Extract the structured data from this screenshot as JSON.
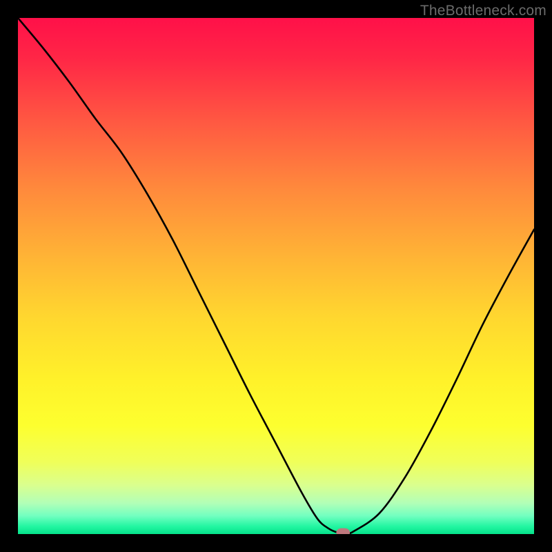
{
  "watermark": "TheBottleneck.com",
  "chart_data": {
    "type": "line",
    "title": "",
    "xlabel": "",
    "ylabel": "",
    "xlim": [
      0,
      100
    ],
    "ylim": [
      0,
      100
    ],
    "legend": "none",
    "grid": false,
    "x": [
      0,
      5,
      10,
      15,
      20,
      25,
      30,
      35,
      40,
      45,
      50,
      55,
      58,
      60,
      62,
      64,
      65,
      70,
      75,
      80,
      85,
      90,
      95,
      100
    ],
    "y": [
      100,
      94,
      87.5,
      80.5,
      74,
      66,
      57,
      47,
      37,
      27,
      17.5,
      8,
      3,
      1.2,
      0.3,
      0.3,
      0.5,
      4,
      11,
      20,
      30,
      40.5,
      50,
      59
    ],
    "marker": {
      "x": 63,
      "y": 0.3,
      "color": "#be787d",
      "radius": 1.2
    },
    "background": {
      "type": "vertical-gradient",
      "stops": [
        {
          "offset": 0.0,
          "color": "#ff1049"
        },
        {
          "offset": 0.08,
          "color": "#ff2746"
        },
        {
          "offset": 0.2,
          "color": "#ff5842"
        },
        {
          "offset": 0.33,
          "color": "#ff893c"
        },
        {
          "offset": 0.47,
          "color": "#ffb635"
        },
        {
          "offset": 0.58,
          "color": "#ffd72f"
        },
        {
          "offset": 0.7,
          "color": "#fff12a"
        },
        {
          "offset": 0.79,
          "color": "#fdff2f"
        },
        {
          "offset": 0.86,
          "color": "#f0ff59"
        },
        {
          "offset": 0.905,
          "color": "#daff8e"
        },
        {
          "offset": 0.94,
          "color": "#b2ffb7"
        },
        {
          "offset": 0.965,
          "color": "#71ffc0"
        },
        {
          "offset": 0.985,
          "color": "#23f6a2"
        },
        {
          "offset": 1.0,
          "color": "#05e28a"
        }
      ]
    }
  }
}
